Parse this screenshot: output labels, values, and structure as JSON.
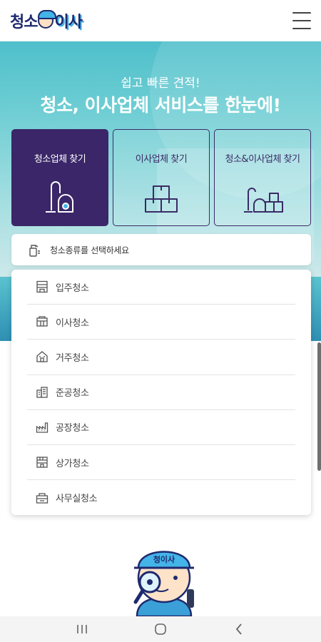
{
  "header": {
    "logo_part1": "청소",
    "logo_part2": "이사",
    "logo_icon": "mascot-icon",
    "menu_icon": "hamburger-menu-icon"
  },
  "hero": {
    "subtitle": "쉽고 빠른 견적!",
    "title": "청소, 이사업체 서비스를 한눈에!"
  },
  "categories": [
    {
      "label": "청소업체 찾기",
      "icon": "vacuum-cleaner-icon",
      "active": true
    },
    {
      "label": "이사업체 찾기",
      "icon": "moving-boxes-icon",
      "active": false
    },
    {
      "label": "청소&이사업체 찾기",
      "icon": "clean-and-move-icon",
      "active": false
    }
  ],
  "select": {
    "placeholder": "청소종류를 선택하세요",
    "icon": "spray-cleaner-icon"
  },
  "dropdown": {
    "items": [
      {
        "label": "입주청소",
        "icon": "building-icon"
      },
      {
        "label": "이사청소",
        "icon": "moving-truck-icon"
      },
      {
        "label": "거주청소",
        "icon": "house-icon"
      },
      {
        "label": "준공청소",
        "icon": "construction-icon"
      },
      {
        "label": "공장청소",
        "icon": "factory-icon"
      },
      {
        "label": "상가청소",
        "icon": "shop-icon"
      },
      {
        "label": "사무실청소",
        "icon": "office-icon"
      }
    ]
  },
  "mascot": {
    "cap_text": "청이사",
    "icon": "mascot-with-magnifier-icon"
  },
  "system_nav": {
    "recent_icon": "recent-apps-icon",
    "home_icon": "home-icon",
    "back_icon": "back-icon"
  },
  "colors": {
    "brand_navy": "#1e2a6e",
    "brand_sky": "#43b3e8",
    "active_card": "#3a2668",
    "hero_teal": "#4fbfcb"
  }
}
